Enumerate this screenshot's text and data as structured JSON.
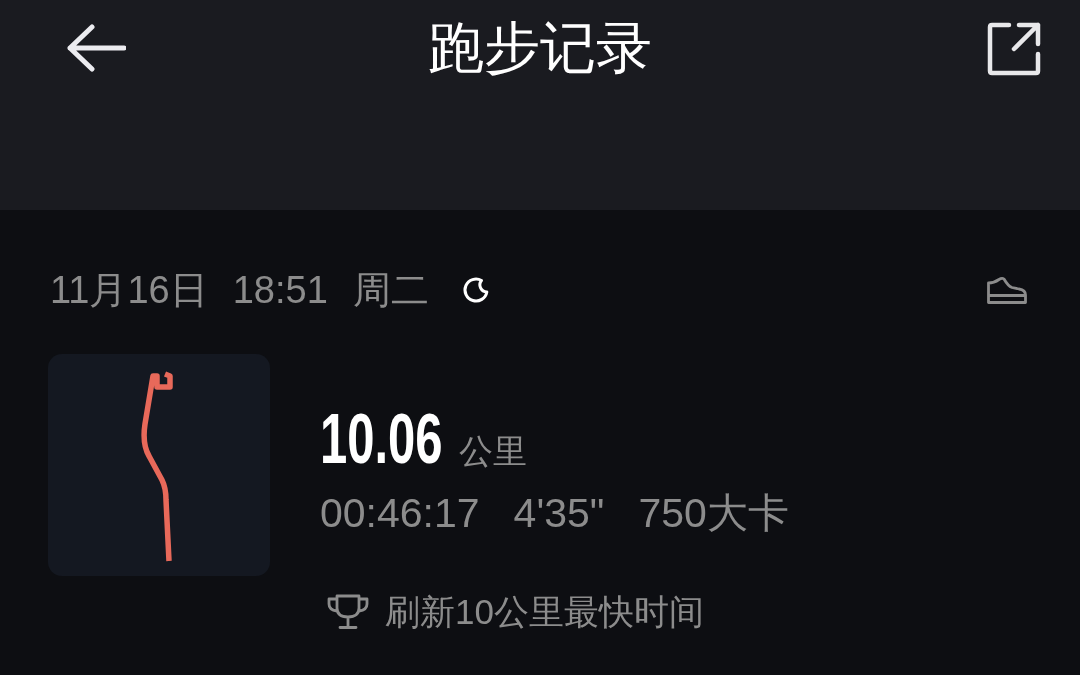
{
  "header": {
    "title": "跑步记录"
  },
  "records": [
    {
      "date": "11月16日",
      "time": "18:51",
      "weekday": "周二",
      "distance": "10.06",
      "distance_unit": "公里",
      "duration": "00:46:17",
      "pace": "4'35\"",
      "calories": "750大卡",
      "achievement": "刷新10公里最快时间"
    }
  ]
}
